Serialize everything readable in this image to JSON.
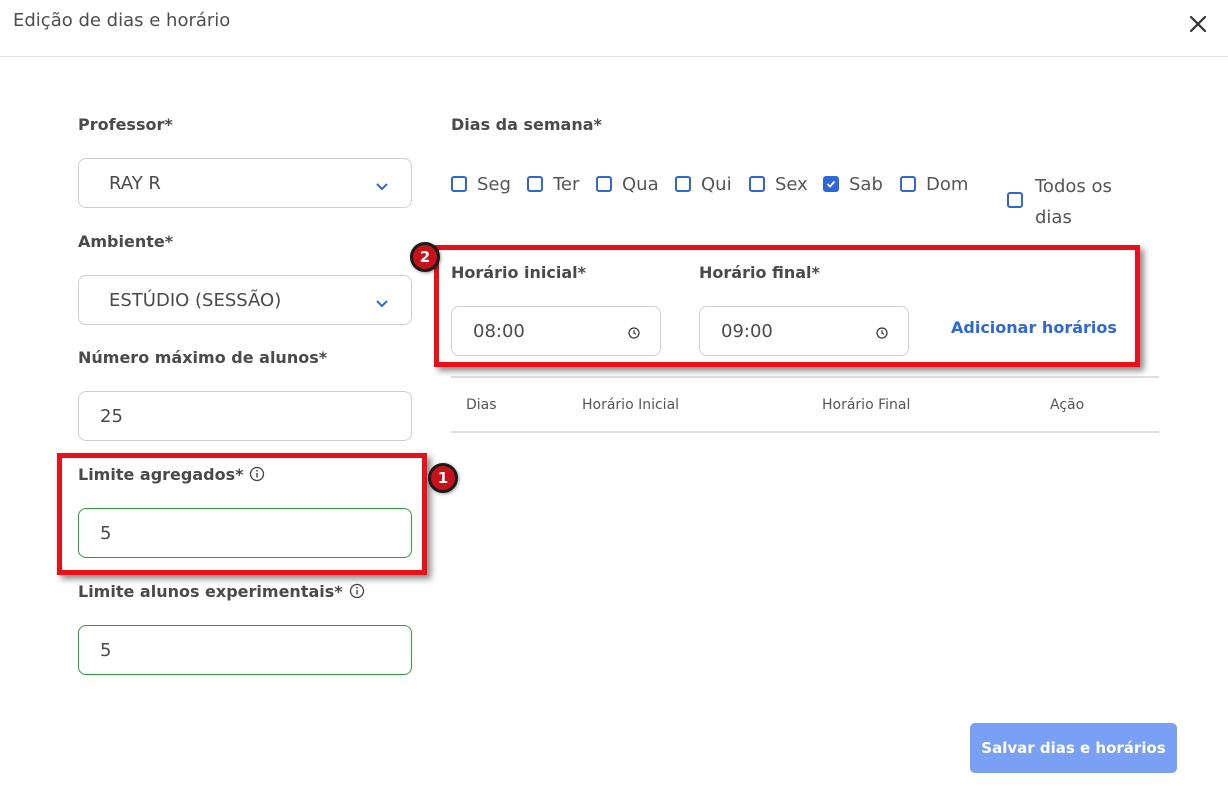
{
  "dialog": {
    "title": "Edição de dias e horário"
  },
  "form": {
    "professor": {
      "label": "Professor*",
      "value": "RAY R"
    },
    "ambiente": {
      "label": "Ambiente*",
      "value": "ESTÚDIO (SESSÃO)"
    },
    "max_alunos": {
      "label": "Número máximo de alunos*",
      "value": "25"
    },
    "limite_agregados": {
      "label": "Limite agregados*",
      "value": "5"
    },
    "limite_experimentais": {
      "label": "Limite alunos experimentais*",
      "value": "5"
    }
  },
  "days": {
    "label": "Dias da semana*",
    "items": [
      {
        "label": "Seg",
        "checked": false
      },
      {
        "label": "Ter",
        "checked": false
      },
      {
        "label": "Qua",
        "checked": false
      },
      {
        "label": "Qui",
        "checked": false
      },
      {
        "label": "Sex",
        "checked": false
      },
      {
        "label": "Sab",
        "checked": true
      },
      {
        "label": "Dom",
        "checked": false
      }
    ],
    "all_label": "Todos os dias",
    "all_checked": false
  },
  "schedule": {
    "start_label": "Horário inicial*",
    "start_value": "08:00",
    "end_label": "Horário final*",
    "end_value": "09:00",
    "add_label": "Adicionar horários"
  },
  "table": {
    "columns": [
      "Dias",
      "Horário Inicial",
      "Horário Final",
      "Ação"
    ]
  },
  "annotations": {
    "badge_1": "1",
    "badge_2": "2"
  },
  "footer": {
    "save_label": "Salvar dias e horários"
  },
  "colors": {
    "accent": "#2f67d8",
    "highlight": "#e8111a",
    "valid_border": "#2e9e3e",
    "save_button": "#79a0f5"
  }
}
